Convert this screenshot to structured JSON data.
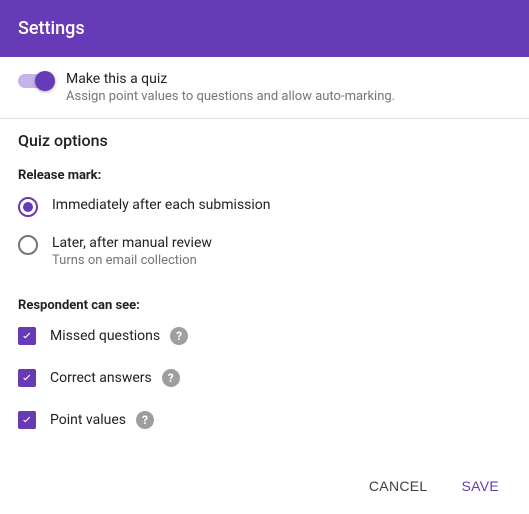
{
  "header": {
    "title": "Settings"
  },
  "quiz_toggle": {
    "label": "Make this a quiz",
    "sub": "Assign point values to questions and allow auto-marking.",
    "on": true
  },
  "quiz_options": {
    "title": "Quiz options",
    "release": {
      "title": "Release mark:",
      "options": [
        {
          "label": "Immediately after each submission",
          "sub": "",
          "selected": true
        },
        {
          "label": "Later, after manual review",
          "sub": "Turns on email collection",
          "selected": false
        }
      ]
    },
    "respondent": {
      "title": "Respondent can see:",
      "options": [
        {
          "label": "Missed questions",
          "checked": true
        },
        {
          "label": "Correct answers",
          "checked": true
        },
        {
          "label": "Point values",
          "checked": true
        }
      ]
    }
  },
  "footer": {
    "cancel": "Cancel",
    "save": "Save"
  },
  "colors": {
    "accent": "#673ab7"
  }
}
